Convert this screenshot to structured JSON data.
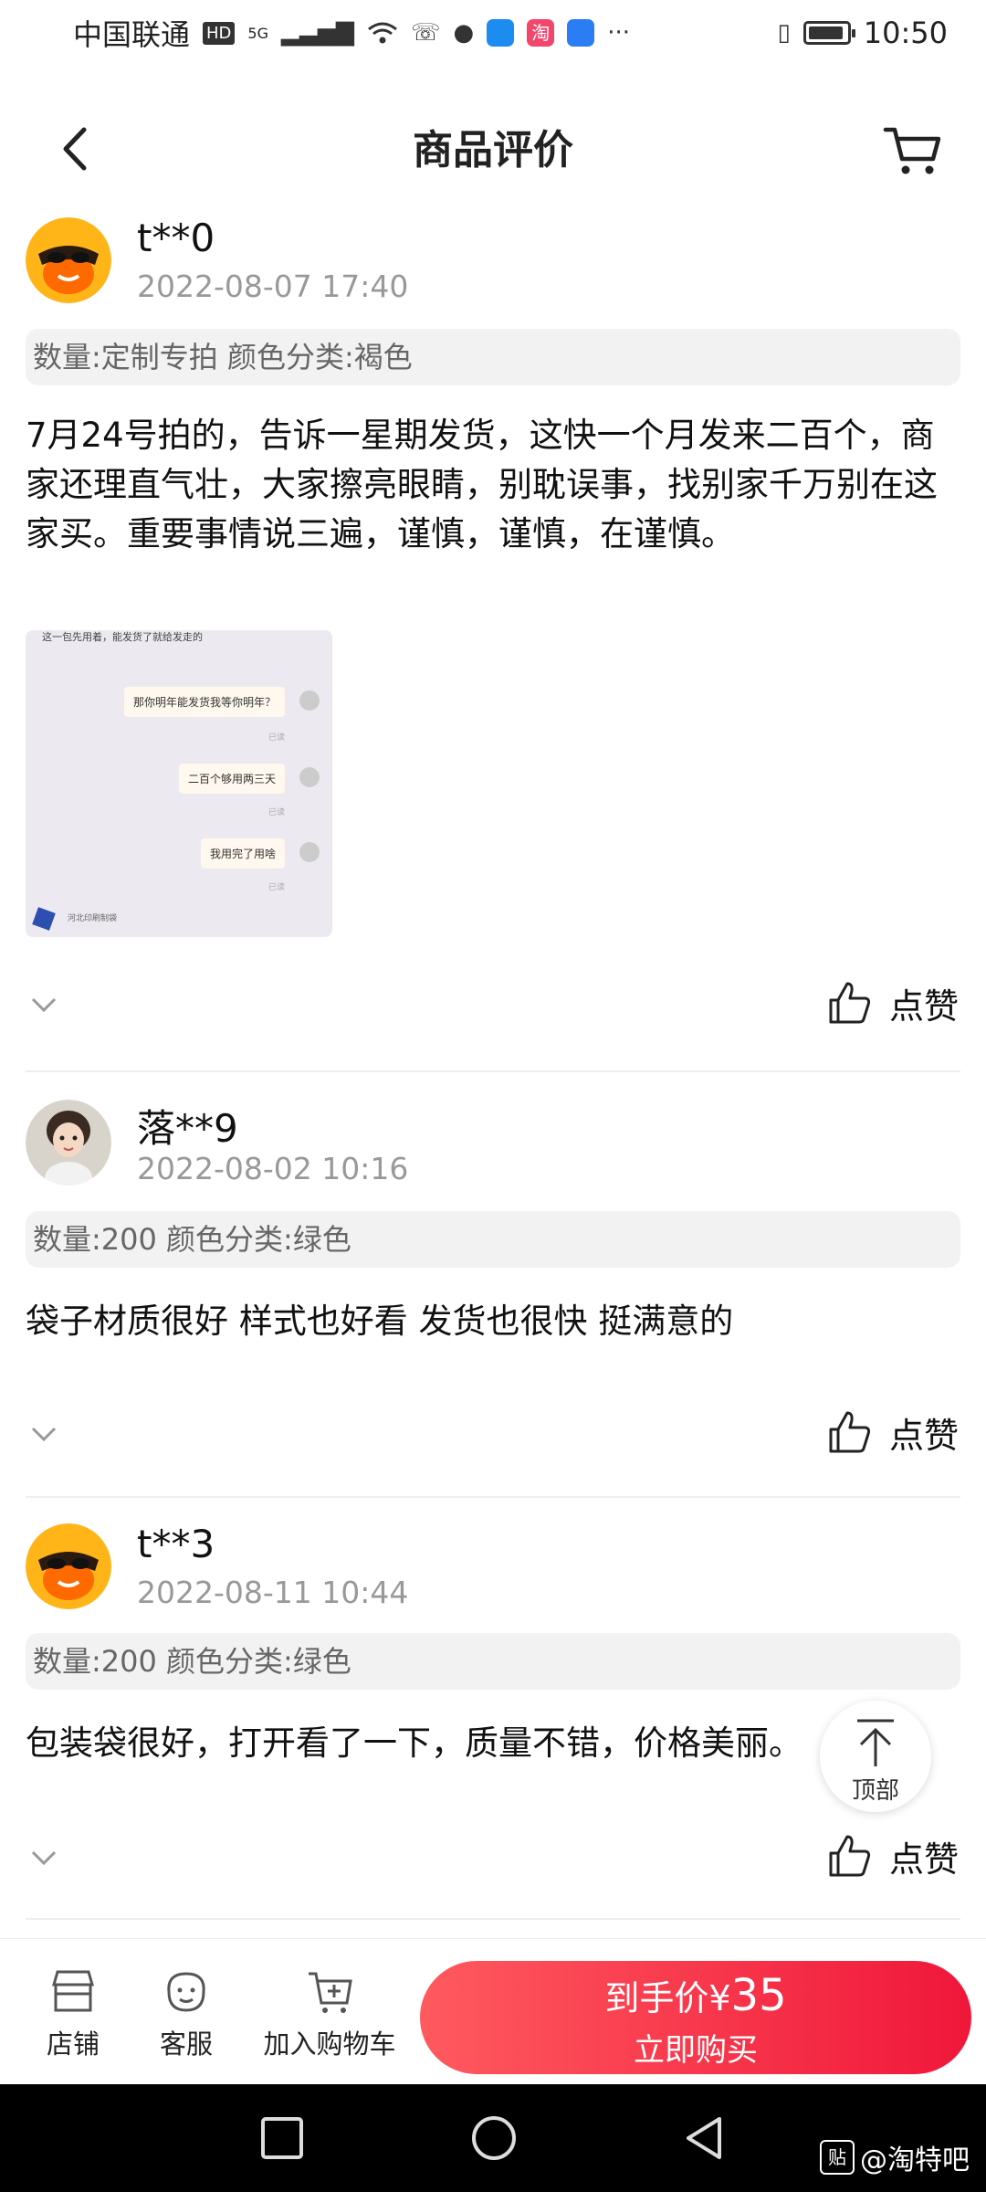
{
  "status_bar": {
    "carrier": "中国联通",
    "hd": "HD",
    "network": "5G",
    "time": "10:50",
    "taobao_icon_label": "淘"
  },
  "header": {
    "title": "商品评价"
  },
  "reviews": [
    {
      "username": "t**0",
      "date": "2022-08-07 17:40",
      "sku": "数量:定制专拍 颜色分类:褐色",
      "content": "7月24号拍的，告诉一星期发货，这快一个月发来二百个，商家还理直气壮，大家擦亮眼睛，别耽误事，找别家千万别在这家买。重要事情说三遍，谨慎，谨慎，在谨慎。",
      "like_label": "点赞",
      "image": {
        "chat_lines": [
          "这一包先用着，能发货了就给发走的",
          "那你明年能发货我等你明年？",
          "二百个够用两三天",
          "我用完了用啥"
        ],
        "read_mark": "已读",
        "footer": "河北印刷制袋"
      }
    },
    {
      "username": "落**9",
      "date": "2022-08-02 10:16",
      "sku": "数量:200 颜色分类:绿色",
      "content": "袋子材质很好 样式也好看 发货也很快 挺满意的",
      "like_label": "点赞"
    },
    {
      "username": "t**3",
      "date": "2022-08-11 10:44",
      "sku": "数量:200 颜色分类:绿色",
      "content": "包装袋很好，打开看了一下，质量不错，价格美丽。",
      "like_label": "点赞"
    }
  ],
  "back_to_top_label": "顶部",
  "bottom_bar": {
    "store_label": "店铺",
    "service_label": "客服",
    "add_cart_label": "加入购物车",
    "price_prefix": "到手价¥",
    "price_value": "35",
    "buy_label": "立即购买"
  },
  "watermark": {
    "logo": "贴",
    "text": "@淘特吧"
  },
  "colors": {
    "accent": "#f0173a",
    "accent_light": "#ff5a5f",
    "muted_text": "#999999",
    "sku_bg": "#f2f2f2"
  }
}
